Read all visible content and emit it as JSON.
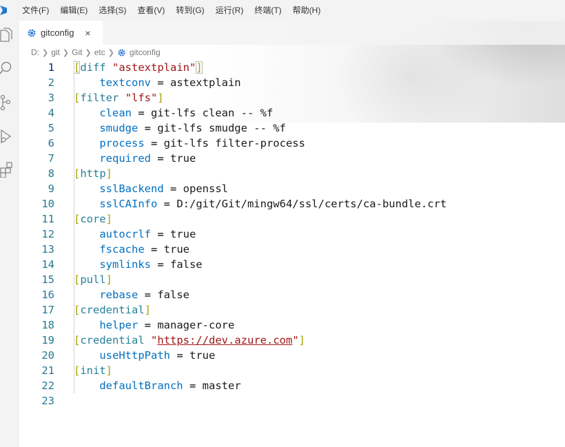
{
  "menu": [
    "文件(F)",
    "编辑(E)",
    "选择(S)",
    "查看(V)",
    "转到(G)",
    "运行(R)",
    "终端(T)",
    "帮助(H)"
  ],
  "activity_icons": [
    "files-icon",
    "search-icon",
    "source-control-icon",
    "run-debug-icon",
    "extensions-icon"
  ],
  "tab": {
    "label": "gitconfig",
    "close": "×"
  },
  "breadcrumb": [
    "D:",
    "git",
    "Git",
    "etc",
    "gitconfig"
  ],
  "editor": {
    "active_line": 1,
    "lines": [
      {
        "n": "1",
        "section": "diff",
        "name": "\"astextplain\""
      },
      {
        "n": "2",
        "key": "textconv",
        "value": "astextplain"
      },
      {
        "n": "3",
        "section": "filter",
        "name": "\"lfs\""
      },
      {
        "n": "4",
        "key": "clean",
        "value": "git-lfs clean -- %f"
      },
      {
        "n": "5",
        "key": "smudge",
        "value": "git-lfs smudge -- %f"
      },
      {
        "n": "6",
        "key": "process",
        "value": "git-lfs filter-process"
      },
      {
        "n": "7",
        "key": "required",
        "value": "true"
      },
      {
        "n": "8",
        "section": "http"
      },
      {
        "n": "9",
        "key": "sslBackend",
        "value": "openssl"
      },
      {
        "n": "10",
        "key": "sslCAInfo",
        "value": "D:/git/Git/mingw64/ssl/certs/ca-bundle.crt"
      },
      {
        "n": "11",
        "section": "core"
      },
      {
        "n": "12",
        "key": "autocrlf",
        "value": "true"
      },
      {
        "n": "13",
        "key": "fscache",
        "value": "true"
      },
      {
        "n": "14",
        "key": "symlinks",
        "value": "false"
      },
      {
        "n": "15",
        "section": "pull"
      },
      {
        "n": "16",
        "key": "rebase",
        "value": "false"
      },
      {
        "n": "17",
        "section": "credential"
      },
      {
        "n": "18",
        "key": "helper",
        "value": "manager-core"
      },
      {
        "n": "19",
        "section": "credential",
        "url": "https://dev.azure.com"
      },
      {
        "n": "20",
        "key": "useHttpPath",
        "value": "true"
      },
      {
        "n": "21",
        "section": "init"
      },
      {
        "n": "22",
        "key": "defaultBranch",
        "value": "master"
      },
      {
        "n": "23"
      }
    ]
  }
}
